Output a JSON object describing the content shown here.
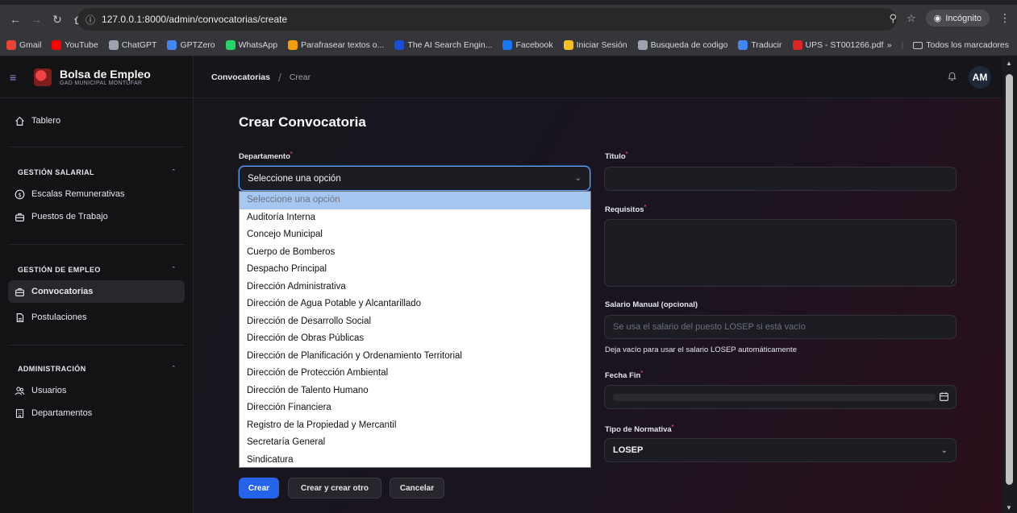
{
  "browser": {
    "url": "127.0.0.1:8000/admin/convocatorias/create",
    "incognito_label": "Incógnito",
    "bookmarks": [
      {
        "label": "Gmail",
        "color": "#ea4335"
      },
      {
        "label": "YouTube",
        "color": "#ff0000"
      },
      {
        "label": "ChatGPT",
        "color": "#9ca3af"
      },
      {
        "label": "GPTZero",
        "color": "#4285f4"
      },
      {
        "label": "WhatsApp",
        "color": "#25d366"
      },
      {
        "label": "Parafrasear textos o...",
        "color": "#f59e0b"
      },
      {
        "label": "The AI Search Engin...",
        "color": "#1d4ed8"
      },
      {
        "label": "Facebook",
        "color": "#1877f2"
      },
      {
        "label": "Iniciar Sesión",
        "color": "#fbbf24"
      },
      {
        "label": "Busqueda de codigo",
        "color": "#9ca3af"
      },
      {
        "label": "Traducir",
        "color": "#4285f4"
      },
      {
        "label": "UPS - ST001266.pdf",
        "color": "#dc2626"
      }
    ],
    "bookmarks_more": "»",
    "all_bookmarks": "Todos los marcadores"
  },
  "brand": {
    "title": "Bolsa de Empleo",
    "subtitle": "GAD MUNICIPAL MONTÚFAR"
  },
  "sidebar": {
    "dashboard": "Tablero",
    "groups": [
      {
        "title": "GESTIÓN SALARIAL",
        "items": [
          "Escalas Remunerativas",
          "Puestos de Trabajo"
        ]
      },
      {
        "title": "GESTIÓN DE EMPLEO",
        "items": [
          "Convocatorias",
          "Postulaciones"
        ]
      },
      {
        "title": "ADMINISTRACIÓN",
        "items": [
          "Usuarios",
          "Departamentos"
        ]
      }
    ]
  },
  "breadcrumb": {
    "parent": "Convocatorias",
    "current": "Crear"
  },
  "user": {
    "initials": "AM"
  },
  "form": {
    "title": "Crear Convocatoria",
    "departamento": {
      "label": "Departamento",
      "value": "Seleccione una opción",
      "options": [
        "Seleccione una opción",
        "Auditoría Interna",
        "Concejo Municipal",
        "Cuerpo de Bomberos",
        "Despacho Principal",
        "Dirección Administrativa",
        "Dirección de Agua Potable y Alcantarillado",
        "Dirección de Desarrollo Social",
        "Dirección de Obras Públicas",
        "Dirección de Planificación y Ordenamiento Territorial",
        "Dirección de Protección Ambiental",
        "Dirección de Talento Humano",
        "Dirección Financiera",
        "Registro de la Propiedad y Mercantil",
        "Secretaría General",
        "Sindicatura"
      ]
    },
    "titulo": {
      "label": "Titulo",
      "value": ""
    },
    "requisitos": {
      "label": "Requisitos",
      "value": ""
    },
    "salario": {
      "label": "Salario Manual (opcional)",
      "placeholder": "Se usa el salario del puesto LOSEP si está vacío",
      "hint": "Deja vacío para usar el salario LOSEP automáticamente"
    },
    "fecha_fin": {
      "label": "Fecha Fin",
      "value": ""
    },
    "tipo_normativa": {
      "label": "Tipo de Normativa",
      "value": "LOSEP"
    },
    "required_mark": "*",
    "buttons": {
      "create": "Crear",
      "create_another": "Crear y crear otro",
      "cancel": "Cancelar"
    }
  }
}
